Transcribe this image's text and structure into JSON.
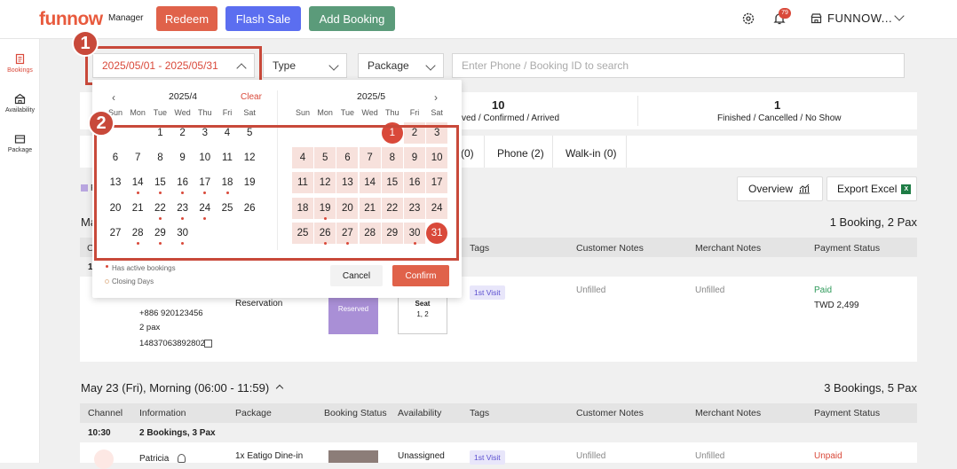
{
  "header": {
    "brand": "funnow",
    "brand_sub": "Manager",
    "redeem": "Redeem",
    "flash_sale": "Flash Sale",
    "add_booking": "Add Booking",
    "notif_count": "79",
    "account": "FUNNOW...",
    "colors": {
      "redeem": "#e0624a",
      "flash": "#5b6ef0",
      "add": "#5b9b7a"
    }
  },
  "sidebar": [
    {
      "label": "Bookings",
      "icon": "bookings-icon"
    },
    {
      "label": "Availability",
      "icon": "store-icon"
    },
    {
      "label": "Package",
      "icon": "package-icon"
    }
  ],
  "filters": {
    "date_range": "2025/05/01 - 2025/05/31",
    "type": "Type",
    "package": "Package",
    "search_placeholder": "Enter Phone / Booking ID to search"
  },
  "callouts": [
    "1",
    "2"
  ],
  "stats": [
    {
      "value": "10",
      "label": "ved / Confirmed / Arrived"
    },
    {
      "value": "1",
      "label": "Finished / Cancelled / No Show"
    }
  ],
  "channel_tabs": [
    "(0)",
    "Phone (2)",
    "Walk-in (0)"
  ],
  "actions": {
    "overview": "Overview",
    "export": "Export Excel"
  },
  "legend_partial": "F",
  "section1": {
    "title_partial": "Ma",
    "summary": "1 Booking, 2 Pax",
    "row_time_partial": "1",
    "col_partial": "C"
  },
  "columns": [
    "Channel",
    "Information",
    "Package",
    "Booking Status",
    "Availability",
    "Tags",
    "Customer Notes",
    "Merchant Notes",
    "Payment Status"
  ],
  "booking1": {
    "phone": "+886 920123456",
    "pax": "2 pax",
    "id": "14837063892802",
    "package": "Reservation",
    "status": "Reserved",
    "seat_label": "Seat",
    "seat": "1, 2",
    "tag": "1st Visit",
    "customer_notes": "Unfilled",
    "merchant_notes": "Unfilled",
    "payment": "Paid",
    "amount": "TWD 2,499"
  },
  "section2": {
    "title": "May 23 (Fri), Morning (06:00 - 11:59)",
    "summary": "3 Bookings, 5 Pax",
    "time": "10:30",
    "group": "2 Bookings, 3 Pax"
  },
  "booking2": {
    "name": "Patricia",
    "package": "1x Eatigo Dine-in",
    "availability": "Unassigned",
    "tag": "1st Visit",
    "customer_notes": "Unfilled",
    "merchant_notes": "Unfilled",
    "payment": "Unpaid"
  },
  "calendar": {
    "left_month": "2025/4",
    "right_month": "2025/5",
    "clear": "Clear",
    "weekdays": [
      "Sun",
      "Mon",
      "Tue",
      "Wed",
      "Thu",
      "Fri",
      "Sat"
    ],
    "april_start": 2,
    "april_days": 30,
    "april_dots": [
      14,
      15,
      16,
      17,
      18,
      22,
      23,
      24,
      28,
      29,
      30
    ],
    "may_start": 4,
    "may_days": 31,
    "may_dots": [
      19,
      26,
      27,
      30
    ],
    "may_selected": [
      1,
      31
    ],
    "legend_active": "Has active bookings",
    "legend_closing": "Closing Days",
    "cancel": "Cancel",
    "confirm": "Confirm"
  }
}
